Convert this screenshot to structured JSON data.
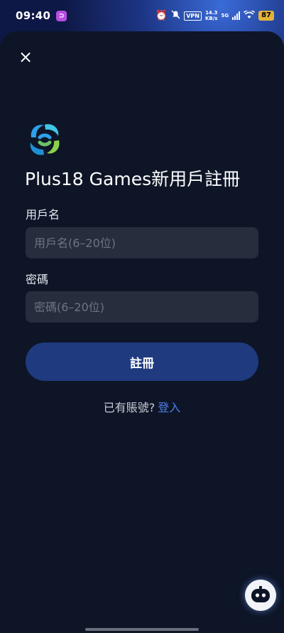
{
  "status_bar": {
    "time": "09:40",
    "app_badge": "⊃",
    "vpn": "VPN",
    "speed_value": "14.3",
    "speed_unit": "KB/s",
    "network": "5G",
    "battery": "87",
    "icons": [
      "alarm-icon",
      "mute-icon",
      "signal-icon",
      "wifi-icon"
    ]
  },
  "close_icon": "×",
  "title": "Plus18 Games新用戶註冊",
  "username": {
    "label": "用戶名",
    "placeholder": "用戶名(6–20位)",
    "value": ""
  },
  "password": {
    "label": "密碼",
    "placeholder": "密碼(6–20位)",
    "value": ""
  },
  "register_button": "註冊",
  "login_prompt": "已有賬號?",
  "login_link": "登入",
  "colors": {
    "background": "#0d1527",
    "input_bg": "#272d3d",
    "button": "#1f3a7e",
    "link": "#4f7fe6"
  }
}
